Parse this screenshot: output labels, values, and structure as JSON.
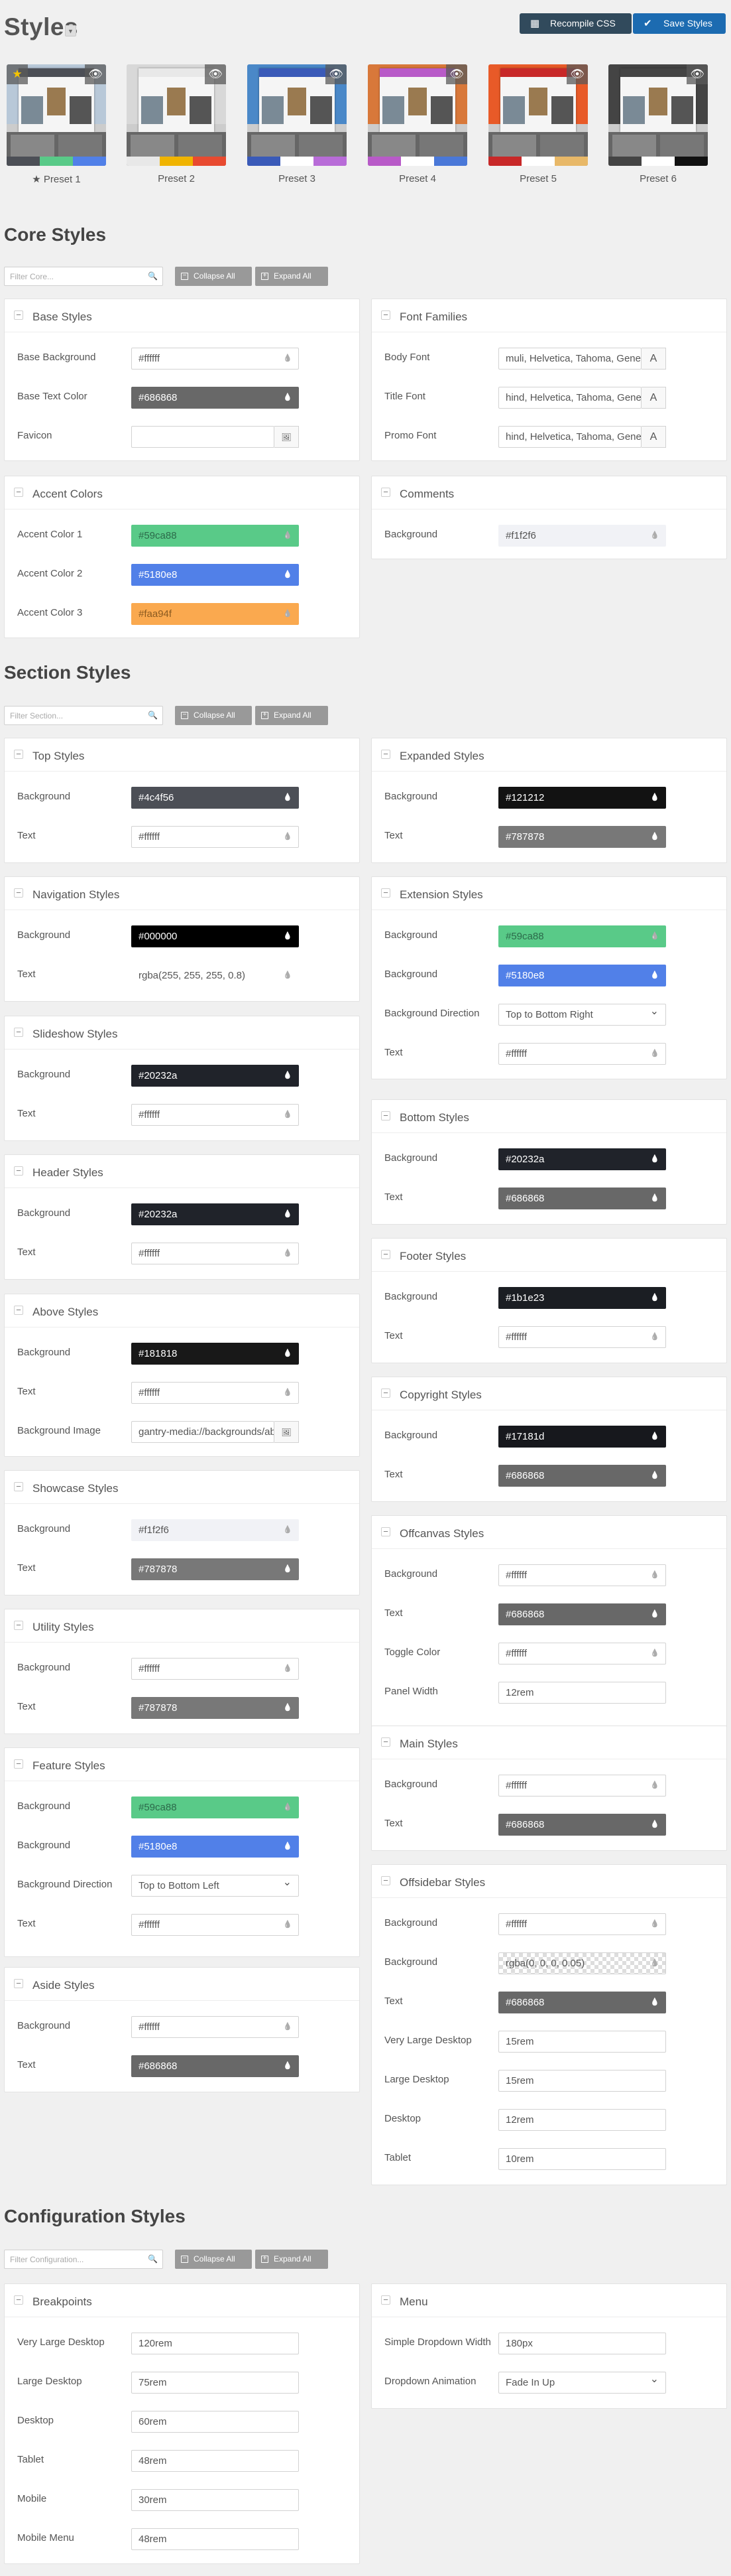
{
  "header": {
    "title": "Styles",
    "recompile_label": "Recompile CSS",
    "save_label": "Save Styles"
  },
  "presets": [
    {
      "label": "Preset 1",
      "active": true,
      "sky": "#b8c8d8",
      "swatches": [
        "#4c4f56",
        "#59ca88",
        "#5180e8"
      ]
    },
    {
      "label": "Preset 2",
      "active": false,
      "sky": "#d8d8d8",
      "swatches": [
        "#e8e8e8",
        "#f0b400",
        "#e84a30"
      ]
    },
    {
      "label": "Preset 3",
      "active": false,
      "sky": "#4a88c8",
      "swatches": [
        "#3a5ab8",
        "#ffffff",
        "#b86cd8"
      ]
    },
    {
      "label": "Preset 4",
      "active": false,
      "sky": "#d8783a",
      "swatches": [
        "#b85ac8",
        "#ffffff",
        "#4a78d8"
      ]
    },
    {
      "label": "Preset 5",
      "active": false,
      "sky": "#e85a28",
      "swatches": [
        "#c82828",
        "#ffffff",
        "#e8b868"
      ]
    },
    {
      "label": "Preset 6",
      "active": false,
      "sky": "#444444",
      "swatches": [
        "#444444",
        "#ffffff",
        "#111111"
      ]
    }
  ],
  "core": {
    "title": "Core Styles",
    "filter_placeholder": "Filter Core...",
    "collapse": "Collapse All",
    "expand": "Expand All"
  },
  "section": {
    "title": "Section Styles",
    "filter_placeholder": "Filter Section...",
    "collapse": "Collapse All",
    "expand": "Expand All"
  },
  "config": {
    "title": "Configuration Styles",
    "filter_placeholder": "Filter Configuration...",
    "collapse": "Collapse All",
    "expand": "Expand All"
  },
  "panels": [
    {
      "id": "base",
      "title": "Base Styles",
      "fields": [
        {
          "label": "Base Background",
          "type": "color",
          "value": "#ffffff",
          "color": "#ffffff"
        },
        {
          "label": "Base Text Color",
          "type": "color",
          "value": "#686868",
          "color": "#686868"
        },
        {
          "label": "Favicon",
          "type": "file",
          "value": ""
        }
      ]
    },
    {
      "id": "fonts",
      "title": "Font Families",
      "fields": [
        {
          "label": "Body Font",
          "type": "font",
          "value": "muli, Helvetica, Tahoma, Geneva, Arial, sans-serif"
        },
        {
          "label": "Title Font",
          "type": "font",
          "value": "hind, Helvetica, Tahoma, Geneva, Arial, sans-serif"
        },
        {
          "label": "Promo Font",
          "type": "font",
          "value": "hind, Helvetica, Tahoma, Geneva, Arial, sans-serif"
        }
      ]
    },
    {
      "id": "accent",
      "title": "Accent Colors",
      "fields": [
        {
          "label": "Accent Color 1",
          "type": "color",
          "value": "#59ca88",
          "color": "#59ca88"
        },
        {
          "label": "Accent Color 2",
          "type": "color",
          "value": "#5180e8",
          "color": "#5180e8"
        },
        {
          "label": "Accent Color 3",
          "type": "color",
          "value": "#faa94f",
          "color": "#faa94f"
        }
      ]
    },
    {
      "id": "comments",
      "title": "Comments",
      "fields": [
        {
          "label": "Background",
          "type": "color",
          "value": "#f1f2f6",
          "color": "#f1f2f6"
        }
      ]
    },
    {
      "id": "top",
      "title": "Top Styles",
      "fields": [
        {
          "label": "Background",
          "type": "color",
          "value": "#4c4f56",
          "color": "#4c4f56"
        },
        {
          "label": "Text",
          "type": "color",
          "value": "#ffffff",
          "color": "#ffffff"
        }
      ]
    },
    {
      "id": "expanded",
      "title": "Expanded Styles",
      "fields": [
        {
          "label": "Background",
          "type": "color",
          "value": "#121212",
          "color": "#121212"
        },
        {
          "label": "Text",
          "type": "color",
          "value": "#787878",
          "color": "#787878"
        }
      ]
    },
    {
      "id": "navigation",
      "title": "Navigation Styles",
      "fields": [
        {
          "label": "Background",
          "type": "color",
          "value": "#000000",
          "color": "#000000"
        },
        {
          "label": "Text",
          "type": "color",
          "value": "rgba(255, 255, 255, 0.8)",
          "color": "rgba(255,255,255,0.8)"
        }
      ]
    },
    {
      "id": "extension",
      "title": "Extension Styles",
      "fields": [
        {
          "label": "Background",
          "type": "color",
          "value": "#59ca88",
          "color": "#59ca88"
        },
        {
          "label": "Background",
          "type": "color",
          "value": "#5180e8",
          "color": "#5180e8"
        },
        {
          "label": "Background Direction",
          "type": "select",
          "value": "Top to Bottom Right"
        },
        {
          "label": "Text",
          "type": "color",
          "value": "#ffffff",
          "color": "#ffffff"
        }
      ]
    },
    {
      "id": "slideshow",
      "title": "Slideshow Styles",
      "fields": [
        {
          "label": "Background",
          "type": "color",
          "value": "#20232a",
          "color": "#20232a"
        },
        {
          "label": "Text",
          "type": "color",
          "value": "#ffffff",
          "color": "#ffffff"
        }
      ]
    },
    {
      "id": "bottom",
      "title": "Bottom Styles",
      "fields": [
        {
          "label": "Background",
          "type": "color",
          "value": "#20232a",
          "color": "#20232a"
        },
        {
          "label": "Text",
          "type": "color",
          "value": "#686868",
          "color": "#686868"
        }
      ]
    },
    {
      "id": "header",
      "title": "Header Styles",
      "fields": [
        {
          "label": "Background",
          "type": "color",
          "value": "#20232a",
          "color": "#20232a"
        },
        {
          "label": "Text",
          "type": "color",
          "value": "#ffffff",
          "color": "#ffffff"
        }
      ]
    },
    {
      "id": "footer",
      "title": "Footer Styles",
      "fields": [
        {
          "label": "Background",
          "type": "color",
          "value": "#1b1e23",
          "color": "#1b1e23"
        },
        {
          "label": "Text",
          "type": "color",
          "value": "#ffffff",
          "color": "#ffffff"
        }
      ]
    },
    {
      "id": "above",
      "title": "Above Styles",
      "fields": [
        {
          "label": "Background",
          "type": "color",
          "value": "#181818",
          "color": "#181818"
        },
        {
          "label": "Text",
          "type": "color",
          "value": "#ffffff",
          "color": "#ffffff"
        },
        {
          "label": "Background Image",
          "type": "file",
          "value": "gantry-media://backgrounds/above/img01.jpg"
        }
      ]
    },
    {
      "id": "copyright",
      "title": "Copyright Styles",
      "fields": [
        {
          "label": "Background",
          "type": "color",
          "value": "#17181d",
          "color": "#17181d"
        },
        {
          "label": "Text",
          "type": "color",
          "value": "#686868",
          "color": "#686868"
        }
      ]
    },
    {
      "id": "showcase",
      "title": "Showcase Styles",
      "fields": [
        {
          "label": "Background",
          "type": "color",
          "value": "#f1f2f6",
          "color": "#f1f2f6"
        },
        {
          "label": "Text",
          "type": "color",
          "value": "#787878",
          "color": "#787878"
        }
      ]
    },
    {
      "id": "offcanvas",
      "title": "Offcanvas Styles",
      "fields": [
        {
          "label": "Background",
          "type": "color",
          "value": "#ffffff",
          "color": "#ffffff"
        },
        {
          "label": "Text",
          "type": "color",
          "value": "#686868",
          "color": "#686868"
        },
        {
          "label": "Toggle Color",
          "type": "color",
          "value": "#ffffff",
          "color": "#ffffff"
        },
        {
          "label": "Panel Width",
          "type": "text",
          "value": "12rem"
        }
      ]
    },
    {
      "id": "utility",
      "title": "Utility Styles",
      "fields": [
        {
          "label": "Background",
          "type": "color",
          "value": "#ffffff",
          "color": "#ffffff"
        },
        {
          "label": "Text",
          "type": "color",
          "value": "#787878",
          "color": "#787878"
        }
      ]
    },
    {
      "id": "main",
      "title": "Main Styles",
      "fields": [
        {
          "label": "Background",
          "type": "color",
          "value": "#ffffff",
          "color": "#ffffff"
        },
        {
          "label": "Text",
          "type": "color",
          "value": "#686868",
          "color": "#686868"
        }
      ]
    },
    {
      "id": "feature",
      "title": "Feature Styles",
      "fields": [
        {
          "label": "Background",
          "type": "color",
          "value": "#59ca88",
          "color": "#59ca88"
        },
        {
          "label": "Background",
          "type": "color",
          "value": "#5180e8",
          "color": "#5180e8"
        },
        {
          "label": "Background Direction",
          "type": "select",
          "value": "Top to Bottom Left"
        },
        {
          "label": "Text",
          "type": "color",
          "value": "#ffffff",
          "color": "#ffffff"
        }
      ]
    },
    {
      "id": "offsidebar",
      "title": "Offsidebar Styles",
      "fields": [
        {
          "label": "Background",
          "type": "color",
          "value": "#ffffff",
          "color": "#ffffff"
        },
        {
          "label": "Background",
          "type": "color",
          "value": "rgba(0, 0, 0, 0.05)",
          "color": "rgba(0,0,0,0.05)"
        },
        {
          "label": "Text",
          "type": "color",
          "value": "#686868",
          "color": "#686868"
        },
        {
          "label": "Very Large Desktop",
          "type": "text",
          "value": "15rem"
        },
        {
          "label": "Large Desktop",
          "type": "text",
          "value": "15rem"
        },
        {
          "label": "Desktop",
          "type": "text",
          "value": "12rem"
        },
        {
          "label": "Tablet",
          "type": "text",
          "value": "10rem"
        }
      ]
    },
    {
      "id": "aside",
      "title": "Aside Styles",
      "fields": [
        {
          "label": "Background",
          "type": "color",
          "value": "#ffffff",
          "color": "#ffffff"
        },
        {
          "label": "Text",
          "type": "color",
          "value": "#686868",
          "color": "#686868"
        }
      ]
    },
    {
      "id": "breakpoints",
      "title": "Breakpoints",
      "fields": [
        {
          "label": "Very Large Desktop",
          "type": "text",
          "value": "120rem"
        },
        {
          "label": "Large Desktop",
          "type": "text",
          "value": "75rem"
        },
        {
          "label": "Desktop",
          "type": "text",
          "value": "60rem"
        },
        {
          "label": "Tablet",
          "type": "text",
          "value": "48rem"
        },
        {
          "label": "Mobile",
          "type": "text",
          "value": "30rem"
        },
        {
          "label": "Mobile Menu",
          "type": "text",
          "value": "48rem"
        }
      ]
    },
    {
      "id": "menu",
      "title": "Menu",
      "fields": [
        {
          "label": "Simple Dropdown Width",
          "type": "text",
          "value": "180px"
        },
        {
          "label": "Dropdown Animation",
          "type": "select",
          "value": "Fade In Up"
        }
      ]
    }
  ]
}
